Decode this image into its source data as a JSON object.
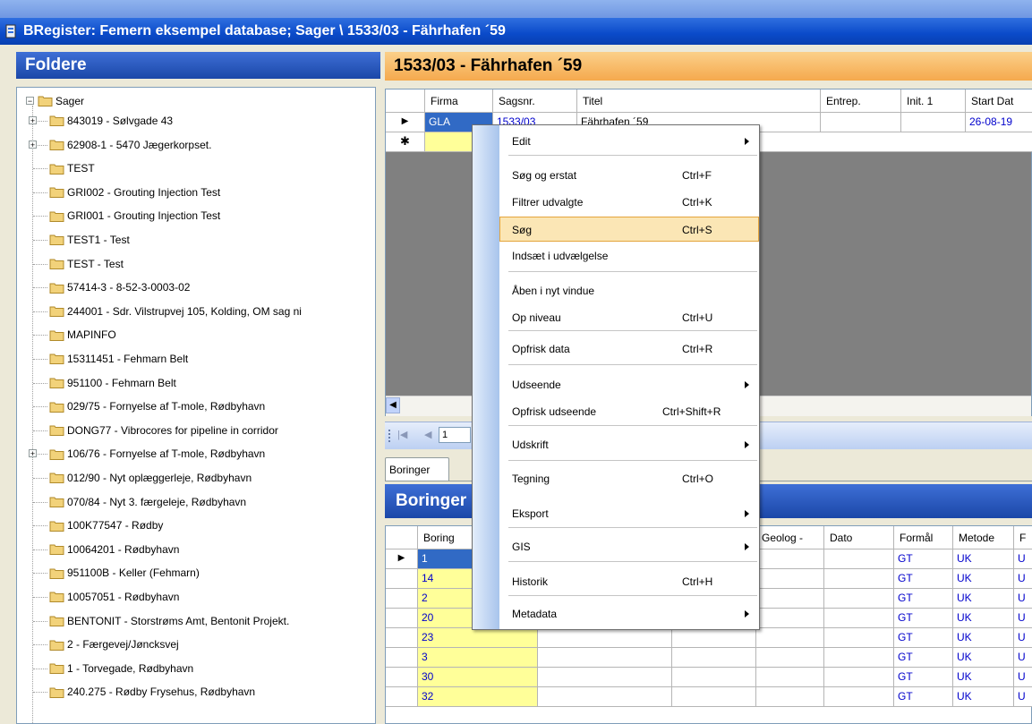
{
  "window": {
    "title": "BRegister: Femern eksempel database; Sager \\ 1533/03 - Fährhafen ´59"
  },
  "folders": {
    "header": "Foldere",
    "root": "Sager",
    "items": [
      "843019 - Sølvgade 43",
      "62908-1 - 5470  Jægerkorpset.",
      "TEST",
      "GRI002 - Grouting Injection Test",
      "GRI001 - Grouting Injection Test",
      "TEST1 - Test",
      "TEST - Test",
      "57414-3 - 8-52-3-0003-02",
      "244001 - Sdr. Vilstrupvej 105, Kolding, OM sag ni",
      "MAPINFO",
      "15311451 - Fehmarn Belt",
      "951100 - Fehmarn Belt",
      "029/75 - Fornyelse af T-mole, Rødbyhavn",
      "DONG77 - Vibrocores for pipeline in corridor",
      "106/76 - Fornyelse af T-mole, Rødbyhavn",
      "012/90 - Nyt oplæggerleje, Rødbyhavn",
      "070/84 - Nyt 3. færgeleje, Rødbyhavn",
      "100K77547 - Rødby",
      "10064201 - Rødbyhavn",
      "951100B - Keller (Fehmarn)",
      "10057051 - Rødbyhavn",
      "BENTONIT - Storstrøms Amt, Bentonit Projekt.",
      "2 - Færgevej/Jøncksvej",
      "1 - Torvegade, Rødbyhavn",
      "240.275 - Rødby Frysehus, Rødbyhavn"
    ]
  },
  "case": {
    "header": "1533/03 - Fährhafen ´59",
    "columns": [
      "Firma",
      "Sagsnr.",
      "Titel",
      "Entrep.",
      "Init. 1",
      "Start Dat"
    ],
    "row": {
      "firma": "GLA",
      "sagsnr": "1533/03",
      "titel": "Fährhafen ´59",
      "start": "26-08-19"
    }
  },
  "navigator": {
    "position": "1"
  },
  "tabs": {
    "boringer": "Boringer"
  },
  "borings": {
    "header": "Boringer",
    "columns": [
      "Boring",
      "Geolog -",
      "Dato",
      "Formål",
      "Metode",
      "F"
    ],
    "rows": [
      {
        "boring": "1",
        "formal": "GT",
        "metode": "UK",
        "f": "U"
      },
      {
        "boring": "14",
        "formal": "GT",
        "metode": "UK",
        "f": "U"
      },
      {
        "boring": "2",
        "formal": "GT",
        "metode": "UK",
        "f": "U"
      },
      {
        "boring": "20",
        "formal": "GT",
        "metode": "UK",
        "f": "U"
      },
      {
        "boring": "23",
        "formal": "GT",
        "metode": "UK",
        "f": "U"
      },
      {
        "boring": "3",
        "formal": "GT",
        "metode": "UK",
        "f": "U"
      },
      {
        "boring": "30",
        "formal": "GT",
        "metode": "UK",
        "f": "U"
      },
      {
        "boring": "32",
        "formal": "GT",
        "metode": "UK",
        "f": "U"
      }
    ]
  },
  "context_menu": {
    "items": [
      {
        "label": "Edit",
        "shortcut": "",
        "submenu": true
      },
      {
        "label": "Søg og erstat",
        "shortcut": "Ctrl+F",
        "submenu": false
      },
      {
        "label": "Filtrer udvalgte",
        "shortcut": "Ctrl+K",
        "submenu": false
      },
      {
        "label": "Søg",
        "shortcut": "Ctrl+S",
        "submenu": false
      },
      {
        "label": "Indsæt i udvælgelse",
        "shortcut": "",
        "submenu": false
      },
      {
        "label": "Åben i nyt vindue",
        "shortcut": "",
        "submenu": false
      },
      {
        "label": "Op niveau",
        "shortcut": "Ctrl+U",
        "submenu": false
      },
      {
        "label": "Opfrisk data",
        "shortcut": "Ctrl+R",
        "submenu": false
      },
      {
        "label": "Udseende",
        "shortcut": "",
        "submenu": true
      },
      {
        "label": "Opfrisk udseende",
        "shortcut": "Ctrl+Shift+R",
        "submenu": false
      },
      {
        "label": "Udskrift",
        "shortcut": "",
        "submenu": true
      },
      {
        "label": "Tegning",
        "shortcut": "Ctrl+O",
        "submenu": false
      },
      {
        "label": "Eksport",
        "shortcut": "",
        "submenu": true
      },
      {
        "label": "GIS",
        "shortcut": "",
        "submenu": true
      },
      {
        "label": "Historik",
        "shortcut": "Ctrl+H",
        "submenu": false
      },
      {
        "label": "Metadata",
        "shortcut": "",
        "submenu": true
      }
    ]
  },
  "colors": {
    "title_bar": "#0a4ac9",
    "folder_yellow": "#f2d27a",
    "case_header": "#f5a94d",
    "menu_highlight": "#fbe6b5",
    "key_cell_yellow": "#ffff99"
  }
}
